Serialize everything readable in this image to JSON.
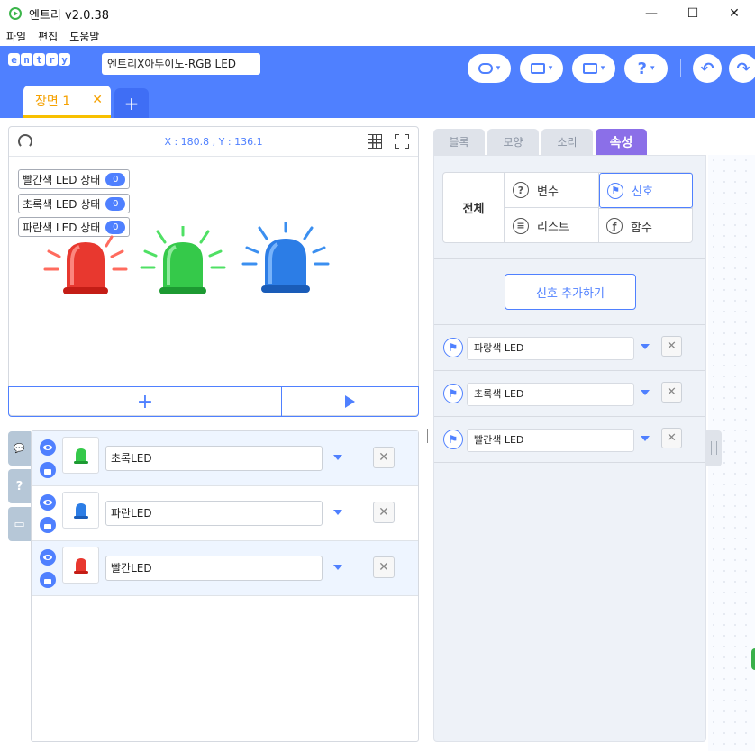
{
  "window": {
    "title": "엔트리 v2.0.38",
    "min": "—",
    "max": "☐",
    "close": "✕"
  },
  "menu": [
    "파일",
    "편집",
    "도움말"
  ],
  "header": {
    "logo_letters": [
      "e",
      "n",
      "t",
      "r",
      "y"
    ],
    "project_name": "엔트리X아두이노-RGB LED",
    "help_label": "?",
    "undo": "↶",
    "redo": "↷",
    "colors": {
      "header_bg": "#4f80ff",
      "tab_accent": "#f5a100",
      "active_tab": "#8b6fe8"
    }
  },
  "scene": {
    "tab_label": "장면 1",
    "tab_close": "✕",
    "add_label": "+"
  },
  "stage": {
    "coords": "X : 180.8 , Y : 136.1",
    "variables": [
      {
        "label": "빨간색 LED 상태",
        "value": "0"
      },
      {
        "label": "초록색 LED 상태",
        "value": "0"
      },
      {
        "label": "파란색 LED 상태",
        "value": "0"
      }
    ],
    "add_label": "+"
  },
  "objects": [
    {
      "name": "초록LED",
      "color": "#35c94a",
      "delete": "✕"
    },
    {
      "name": "파란LED",
      "color": "#2c7de6",
      "delete": "✕"
    },
    {
      "name": "빨간LED",
      "color": "#e8382f",
      "delete": "✕"
    }
  ],
  "side_tabs": [
    "💬",
    "?",
    "▭"
  ],
  "right": {
    "tabs": [
      "블록",
      "모양",
      "소리",
      "속성"
    ],
    "category_all": "전체",
    "categories": [
      {
        "label": "변수",
        "icon": "?"
      },
      {
        "label": "신호",
        "icon": "⚑"
      },
      {
        "label": "리스트",
        "icon": "≡"
      },
      {
        "label": "함수",
        "icon": "ƒ"
      }
    ],
    "add_signal": "신호 추가하기",
    "signals": [
      {
        "name": "파랑색 LED",
        "delete": "✕"
      },
      {
        "name": "초록색 LED",
        "delete": "✕"
      },
      {
        "name": "빨간색 LED",
        "delete": "✕"
      }
    ]
  }
}
